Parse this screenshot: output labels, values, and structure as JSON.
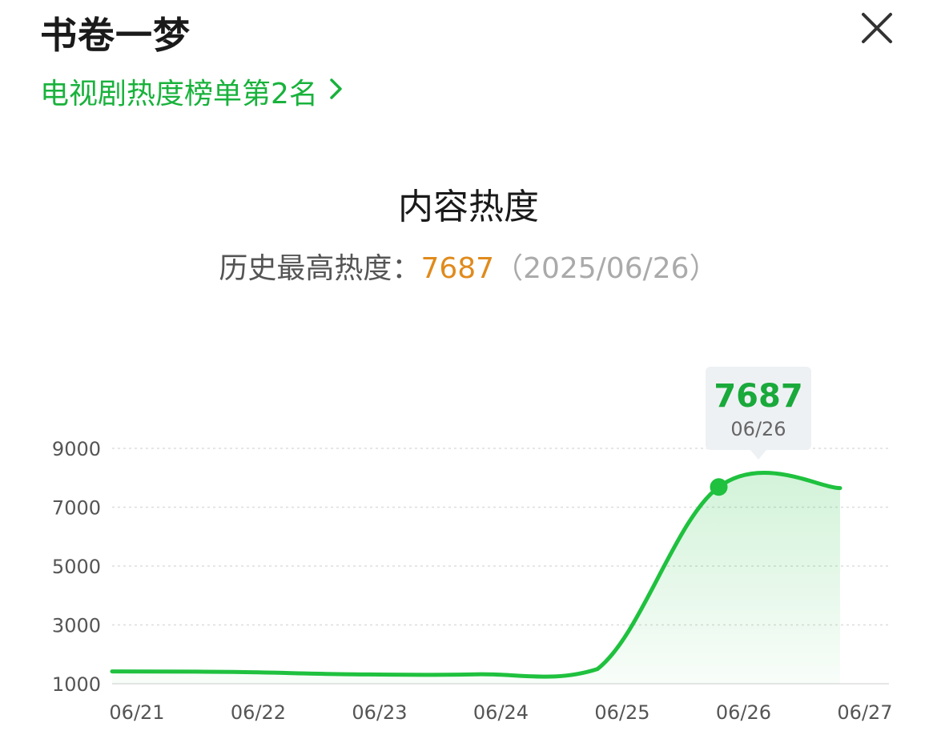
{
  "header": {
    "title": "书卷一梦",
    "rank_link": "电视剧热度榜单第2名",
    "close_icon": "close-icon",
    "chevron_icon": "chevron-right-icon"
  },
  "section": {
    "title": "内容热度",
    "peak_label": "历史最高热度：",
    "peak_value": "7687",
    "peak_date": "（2025/06/26）"
  },
  "tooltip": {
    "value": "7687",
    "date": "06/26"
  },
  "colors": {
    "accent_green": "#19b23c",
    "line_green": "#1fc13e",
    "peak_orange": "#e08a1c"
  },
  "chart_data": {
    "type": "area",
    "x": [
      "06/21",
      "06/22",
      "06/23",
      "06/24",
      "06/25",
      "06/26",
      "06/27"
    ],
    "x_tick_labels": [
      "06/21",
      "06/22",
      "06/23",
      "06/24",
      "06/25",
      "06/26",
      "06/27"
    ],
    "series": [
      {
        "values": [
          1420,
          1400,
          1320,
          1320,
          1500,
          7687,
          7650
        ]
      }
    ],
    "y_tick_labels": [
      "9000",
      "7000",
      "5000",
      "3000",
      "1000"
    ],
    "yticks": [
      9000,
      7000,
      5000,
      3000,
      1000
    ],
    "ylim": [
      1000,
      9000
    ],
    "grid": true,
    "highlight": {
      "x": "06/26",
      "value": 7687
    },
    "title": "",
    "xlabel": "",
    "ylabel": ""
  }
}
